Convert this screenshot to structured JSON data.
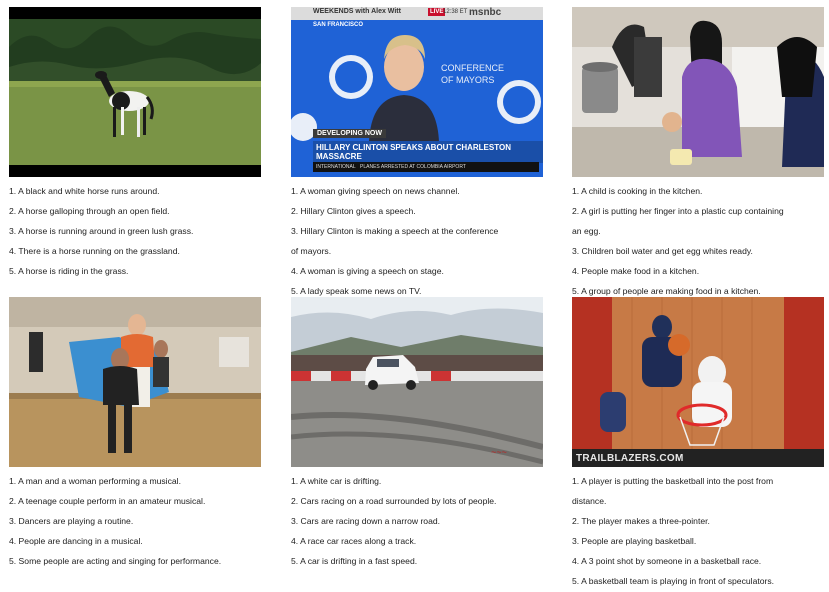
{
  "cells": [
    {
      "captions": [
        "1. A black and white horse runs around.",
        "2. A horse galloping through an open field.",
        "3. A horse is running around in green lush grass.",
        "4. There is a horse running on the grassland.",
        "5. A horse is riding in the grass."
      ]
    },
    {
      "overlay": {
        "channel": "msnbc",
        "show": "WEEKENDS with Alex Witt",
        "live": "LIVE",
        "time": "12:38 ET",
        "location": "SAN FRANCISCO",
        "banner_tag": "DEVELOPING NOW",
        "headline": "HILLARY CLINTON SPEAKS ABOUT CHARLESTON MASSACRE",
        "ticker_label": "INTERNATIONAL",
        "ticker_text": "PLANES ARRESTED AT COLOMBIA AIRPORT",
        "backdrop_text": "CONFERENCE OF MAYORS"
      },
      "captions": [
        "1. A woman giving speech on news channel.",
        "2. Hillary Clinton gives a speech.",
        "3. Hillary Clinton is making a speech at the conference",
        "of mayors.",
        "4. A woman is giving a speech on stage.",
        "5. A lady speak some news on TV."
      ]
    },
    {
      "captions": [
        "1. A child is cooking in the kitchen.",
        "2. A girl is putting her finger into a plastic cup containing",
        "an egg.",
        "3. Children boil water and get egg whites ready.",
        "4. People make food in a kitchen.",
        "5. A group of people are making food in a kitchen."
      ]
    },
    {
      "captions": [
        "1. A man and a woman performing a musical.",
        "2. A teenage couple perform in an amateur musical.",
        "3. Dancers are playing a routine.",
        "4. People are dancing in a musical.",
        "5. Some people are acting and singing for performance."
      ]
    },
    {
      "captions": [
        "1. A white car is drifting.",
        "2. Cars racing on a road surrounded by lots of people.",
        "3. Cars are racing down a narrow road.",
        "4. A race car races along a track.",
        "5. A car is drifting in a fast speed."
      ]
    },
    {
      "overlay": {
        "board_text": "TRAILBLAZERS.COM"
      },
      "captions": [
        "1. A player is putting the basketball into the post from",
        "distance.",
        "2. The player makes a three-pointer.",
        "3. People are playing basketball.",
        "4. A 3 point shot by someone in a basketball race.",
        "5. A basketball team is playing in front of speculators."
      ]
    }
  ]
}
